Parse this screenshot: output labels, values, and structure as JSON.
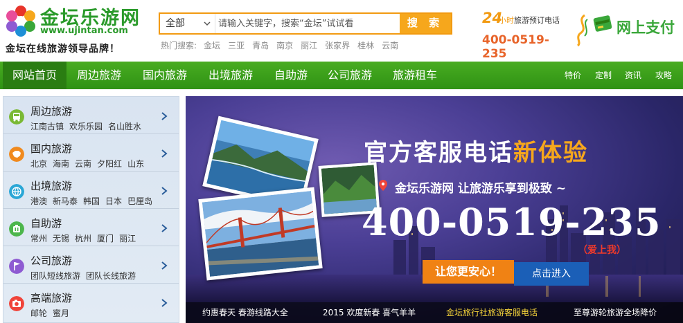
{
  "header": {
    "logo_name": "金坛乐游网",
    "logo_url": "www.ujintan.com",
    "slogan": "金坛在线旅游领导品牌！",
    "search": {
      "category": "全部",
      "placeholder": "请输入关键字，搜索“金坛”试试看",
      "button": "搜 索"
    },
    "hot_label": "热门搜索:",
    "hot_terms": [
      "金坛",
      "三亚",
      "青岛",
      "南京",
      "丽江",
      "张家界",
      "桂林",
      "云南"
    ],
    "hotline_24": "24",
    "hotline_hr": "小时",
    "hotline_text": "旅游预订电话",
    "hotline_number": "400-0519-235",
    "pay_label": "网上支付"
  },
  "nav": {
    "items": [
      "网站首页",
      "周边旅游",
      "国内旅游",
      "出境旅游",
      "自助游",
      "公司旅游",
      "旅游租车"
    ],
    "sub": [
      "特价",
      "定制",
      "资讯",
      "攻略"
    ]
  },
  "sidebar": {
    "items": [
      {
        "title": "周边旅游",
        "subs": [
          "江南古镇",
          "欢乐乐园",
          "名山胜水"
        ],
        "icon": "bus-icon",
        "color": "#7ab934"
      },
      {
        "title": "国内旅游",
        "subs": [
          "北京",
          "海南",
          "云南",
          "夕阳红",
          "山东"
        ],
        "icon": "china-map-icon",
        "color": "#f08a1e"
      },
      {
        "title": "出境旅游",
        "subs": [
          "港澳",
          "新马泰",
          "韩国",
          "日本",
          "巴厘岛"
        ],
        "icon": "globe-icon",
        "color": "#2aa7d6"
      },
      {
        "title": "自助游",
        "subs": [
          "常州",
          "无锡",
          "杭州",
          "厦门",
          "丽江"
        ],
        "icon": "luggage-icon",
        "color": "#4cb64c"
      },
      {
        "title": "公司旅游",
        "subs": [
          "团队短线旅游",
          "团队长线旅游"
        ],
        "icon": "flag-icon",
        "color": "#8e5bd2"
      },
      {
        "title": "高端旅游",
        "subs": [
          "邮轮",
          "蜜月"
        ],
        "icon": "camera-icon",
        "color": "#f0443a"
      }
    ]
  },
  "banner": {
    "headline_main": "官方客服电话",
    "headline_highlight": "新体验",
    "tagline": "金坛乐游网 让旅游乐享到极致 ~",
    "phone": "400-0519-235",
    "love": "（爱上我）",
    "cta_left": "让您更安心！",
    "cta_right": "点击进入",
    "bar": [
      "约惠春天 春游线路大全",
      "2015 欢度新春 喜气羊羊",
      "金坛旅行社旅游客服电话",
      "至尊游轮旅游全场降价"
    ]
  }
}
